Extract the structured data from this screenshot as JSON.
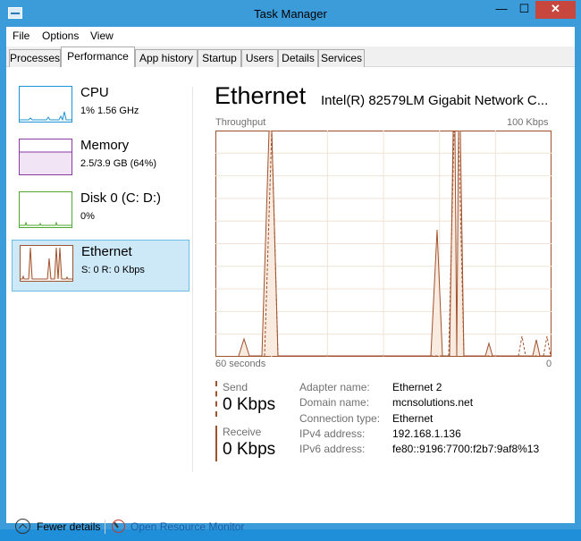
{
  "window": {
    "title": "Task Manager",
    "close_glyph": "✕",
    "min_glyph": "—",
    "max_glyph": "☐"
  },
  "menu": [
    "File",
    "Options",
    "View"
  ],
  "tabs": [
    "Processes",
    "Performance",
    "App history",
    "Startup",
    "Users",
    "Details",
    "Services"
  ],
  "active_tab": "Performance",
  "sidebar": [
    {
      "name": "CPU",
      "sub": "1%  1.56 GHz",
      "color": "#1c93d2"
    },
    {
      "name": "Memory",
      "sub": "2.5/3.9 GB (64%)",
      "color": "#8b3aa4"
    },
    {
      "name": "Disk 0 (C: D:)",
      "sub": "0%",
      "color": "#4ea72e"
    },
    {
      "name": "Ethernet",
      "sub": "S: 0  R: 0 Kbps",
      "color": "#a0522d"
    }
  ],
  "detail": {
    "title": "Ethernet",
    "adapter": "Intel(R) 82579LM Gigabit Network C...",
    "chart_label": "Throughput",
    "max_label": "100 Kbps",
    "time_label": "60 seconds",
    "zero_label": "0",
    "send_label": "Send",
    "send_value": "0 Kbps",
    "receive_label": "Receive",
    "receive_value": "0 Kbps",
    "properties": [
      {
        "label": "Adapter name:",
        "value": "Ethernet 2"
      },
      {
        "label": "Domain name:",
        "value": "mcnsolutions.net"
      },
      {
        "label": "Connection type:",
        "value": "Ethernet"
      },
      {
        "label": "IPv4 address:",
        "value": "192.168.1.136"
      },
      {
        "label": "IPv6 address:",
        "value": "fe80::9196:7700:f2b7:9af8%13"
      }
    ]
  },
  "footer": {
    "fewer_details": "Fewer details",
    "resource_monitor": "Open Resource Monitor"
  },
  "colors": {
    "accent": "#a0522d",
    "grid": "#f0e2d6",
    "fill": "#f9ebe0",
    "selection": "#cde8f7"
  }
}
